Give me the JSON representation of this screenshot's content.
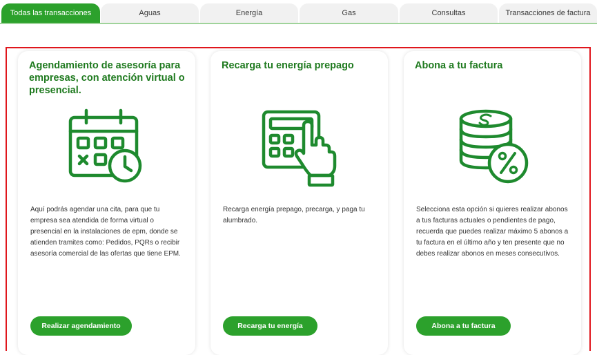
{
  "tabs": [
    {
      "label": "Todas las transacciones",
      "active": true
    },
    {
      "label": "Aguas"
    },
    {
      "label": "Energía"
    },
    {
      "label": "Gas"
    },
    {
      "label": "Consultas"
    },
    {
      "label": "Transacciones de factura"
    }
  ],
  "cards": [
    {
      "title": "Agendamiento de asesoría para empresas, con atención virtual o presencial.",
      "icon": "calendar-icon",
      "description": "Aquí podrás agendar una cita, para que tu empresa sea atendida de forma virtual o presencial en la instalaciones de epm, donde se atienden tramites como: Pedidos, PQRs o recibir asesoría comercial de las ofertas que tiene EPM.",
      "button": "Realizar agendamiento"
    },
    {
      "title": "Recarga tu energía prepago",
      "icon": "calculator-hand-icon",
      "description": "Recarga energía prepago, precarga, y paga tu alumbrado.",
      "button": "Recarga tu energía"
    },
    {
      "title": "Abona a tu factura",
      "icon": "coins-percent-icon",
      "description": "Selecciona esta opción si quieres realizar abonos a tus facturas actuales o pendientes de pago, recuerda que puedes realizar máximo 5 abonos a tu factura en el último año y ten presente que no debes realizar abonos en meses consecutivos.",
      "button": "Abona a tu factura"
    }
  ],
  "colors": {
    "brand_green": "#2ca12c",
    "title_green": "#1f7a1f",
    "icon_green": "#1e8a2e",
    "highlight_red": "#e0161c"
  }
}
